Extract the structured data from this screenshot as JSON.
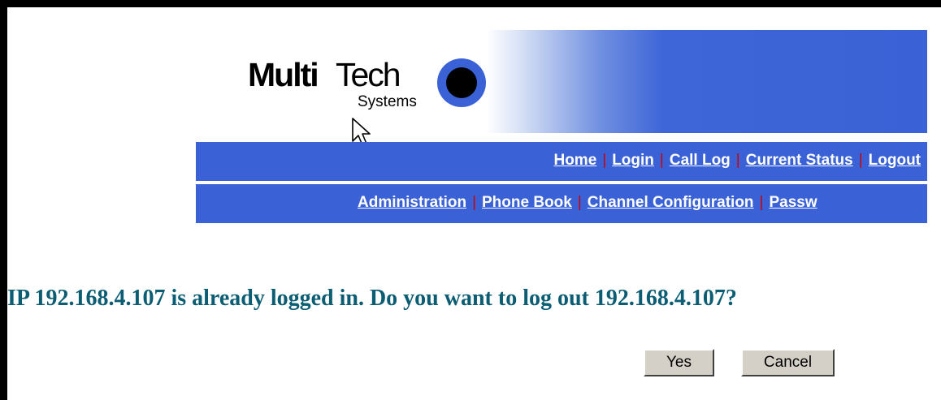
{
  "logo": {
    "brand_bold": "Multi",
    "brand_light": "Tech",
    "tagline": "Systems",
    "registered": "®"
  },
  "nav_primary": [
    {
      "label": "Home"
    },
    {
      "label": "Login"
    },
    {
      "label": "Call Log"
    },
    {
      "label": "Current Status"
    },
    {
      "label": "Logout"
    }
  ],
  "nav_secondary": [
    {
      "label": "Administration"
    },
    {
      "label": "Phone Book"
    },
    {
      "label": "Channel Configuration"
    },
    {
      "label": "Passw"
    }
  ],
  "message": "IP 192.168.4.107 is already logged in. Do you want to log out 192.168.4.107?",
  "buttons": {
    "yes": "Yes",
    "cancel": "Cancel"
  },
  "colors": {
    "nav_background": "#3a62d6",
    "separator": "#cc0000",
    "message_text": "#0b5d73",
    "button_face": "#d4d0c8"
  },
  "icons": {
    "cursor": "arrow-pointer-icon"
  }
}
